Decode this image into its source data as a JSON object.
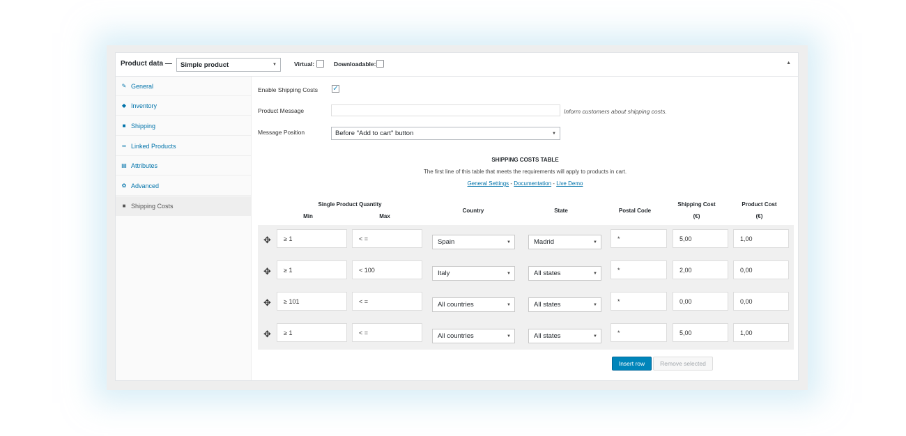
{
  "header": {
    "title": "Product data —",
    "product_type": "Simple product",
    "virtual_label": "Virtual:",
    "downloadable_label": "Downloadable:",
    "collapse_icon": "triangle-up-icon"
  },
  "sidebar": {
    "items": [
      {
        "label": "General",
        "icon": "wrench-icon"
      },
      {
        "label": "Inventory",
        "icon": "tag-icon"
      },
      {
        "label": "Shipping",
        "icon": "truck-icon"
      },
      {
        "label": "Linked Products",
        "icon": "link-icon"
      },
      {
        "label": "Attributes",
        "icon": "list-icon"
      },
      {
        "label": "Advanced",
        "icon": "gear-icon"
      },
      {
        "label": "Shipping Costs",
        "icon": "truck-icon"
      }
    ],
    "active_index": 6
  },
  "form": {
    "enable_label": "Enable Shipping Costs",
    "enable_checked": true,
    "message_label": "Product Message",
    "message_value": "",
    "message_desc": "Inform customers about shipping costs.",
    "position_label": "Message Position",
    "position_value": "Before \"Add to cart\" button"
  },
  "table": {
    "title": "SHIPPING COSTS TABLE",
    "subtitle": "The first line of this table that meets the requirements will apply to products in cart.",
    "links": {
      "settings": "General Settings",
      "sep1": " - ",
      "docs": "Documentation",
      "sep2": " - ",
      "demo": "Live Demo"
    },
    "headers": {
      "quantity": "Single Product Quantity",
      "min": "Min",
      "max": "Max",
      "country": "Country",
      "state": "State",
      "postal": "Postal Code",
      "shipping_cost": "Shipping Cost",
      "shipping_cost_unit": "(€)",
      "product_cost": "Product Cost",
      "product_cost_unit": "(€)"
    },
    "rows": [
      {
        "min": "≥  1",
        "max": "<  =",
        "country": "Spain",
        "state": "Madrid",
        "postal": "*",
        "shipping": "5,00",
        "product": "1,00"
      },
      {
        "min": "≥  1",
        "max": "<  100",
        "country": "Italy",
        "state": "All states",
        "postal": "*",
        "shipping": "2,00",
        "product": "0,00"
      },
      {
        "min": "≥  101",
        "max": "<  =",
        "country": "All countries",
        "state": "All states",
        "postal": "*",
        "shipping": "0,00",
        "product": "0,00"
      },
      {
        "min": "≥  1",
        "max": "<  =",
        "country": "All countries",
        "state": "All states",
        "postal": "*",
        "shipping": "5,00",
        "product": "1,00"
      }
    ]
  },
  "buttons": {
    "insert": "Insert row",
    "remove": "Remove selected"
  },
  "colors": {
    "accent": "#0073aa",
    "primary_button": "#0085ba"
  }
}
